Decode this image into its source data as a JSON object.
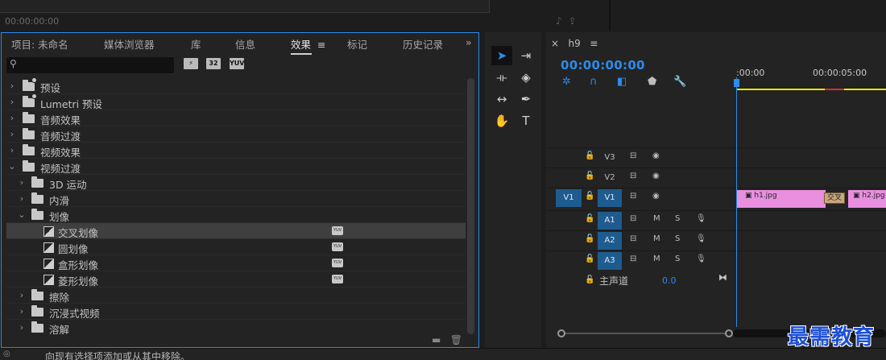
{
  "monitor": {
    "timecode": "00:00:00:00"
  },
  "effects_panel": {
    "tabs": [
      {
        "label": "项目: 未命名"
      },
      {
        "label": "媒体浏览器"
      },
      {
        "label": "库"
      },
      {
        "label": "信息"
      },
      {
        "label": "效果"
      },
      {
        "label": "标记"
      },
      {
        "label": "历史记录"
      }
    ],
    "active_tab": "效果",
    "search": {
      "value": "",
      "placeholder": ""
    },
    "filters": [
      "32",
      "YUV"
    ],
    "tree": [
      {
        "label": "预设",
        "type": "preset-folder",
        "level": 0,
        "expanded": false
      },
      {
        "label": "Lumetri 预设",
        "type": "preset-folder",
        "level": 0,
        "expanded": false
      },
      {
        "label": "音频效果",
        "type": "folder",
        "level": 0,
        "expanded": false
      },
      {
        "label": "音频过渡",
        "type": "folder",
        "level": 0,
        "expanded": false
      },
      {
        "label": "视频效果",
        "type": "folder",
        "level": 0,
        "expanded": false
      },
      {
        "label": "视频过渡",
        "type": "folder",
        "level": 0,
        "expanded": true
      },
      {
        "label": "3D 运动",
        "type": "folder",
        "level": 1,
        "expanded": false
      },
      {
        "label": "内滑",
        "type": "folder",
        "level": 1,
        "expanded": false
      },
      {
        "label": "划像",
        "type": "folder",
        "level": 1,
        "expanded": true
      },
      {
        "label": "交叉划像",
        "type": "effect",
        "level": 2,
        "selected": true
      },
      {
        "label": "圆划像",
        "type": "effect",
        "level": 2
      },
      {
        "label": "盒形划像",
        "type": "effect",
        "level": 2
      },
      {
        "label": "菱形划像",
        "type": "effect",
        "level": 2
      },
      {
        "label": "擦除",
        "type": "folder",
        "level": 1,
        "expanded": false
      },
      {
        "label": "沉浸式视频",
        "type": "folder",
        "level": 1,
        "expanded": false
      },
      {
        "label": "溶解",
        "type": "folder",
        "level": 1,
        "expanded": false
      }
    ]
  },
  "timeline": {
    "sequence_name": "h9",
    "timecode": "00:00:00:00",
    "ruler": [
      ":00:00",
      "00:00:05:00"
    ],
    "tracks": {
      "v3": "V3",
      "v2": "V2",
      "v1": "V1",
      "v1_source": "V1",
      "a1": "A1",
      "a2": "A2",
      "a3": "A3"
    },
    "clips": [
      {
        "label": "h1.jpg"
      },
      {
        "label": "h2.jpg"
      }
    ],
    "transition_label": "交叉",
    "master": {
      "label": "主声道",
      "value": "0.0"
    },
    "mute_label": "M",
    "solo_label": "S"
  },
  "watermark": "最需教育",
  "status": {
    "text": "向现有选择项添加或从其中移除。"
  },
  "colors": {
    "accent": "#2d8ceb",
    "clip": "#e88fe0",
    "transition": "#c9a77c"
  }
}
